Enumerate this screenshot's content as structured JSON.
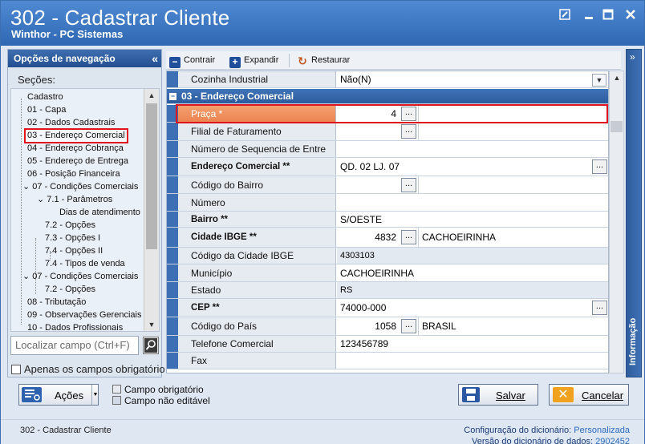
{
  "window": {
    "title": "302 - Cadastrar Cliente",
    "subtitle": "Winthor - PC Sistemas"
  },
  "nav": {
    "header": "Opções de navegação",
    "collapse_glyph": "«",
    "sections_label": "Seções:",
    "tree": [
      {
        "label": "Cadastro"
      },
      {
        "label": "01 - Capa"
      },
      {
        "label": "02 - Dados Cadastrais"
      },
      {
        "label": "03 - Endereço Comercial",
        "selected": true
      },
      {
        "label": "04 - Endereço Cobrança"
      },
      {
        "label": "05 - Endereço de Entrega"
      },
      {
        "label": "06 - Posição Financeira"
      },
      {
        "label": "07 - Condições Comerciais"
      },
      {
        "label": "7.1 - Parâmetros"
      },
      {
        "label": "Dias de atendimento"
      },
      {
        "label": "7.2 - Opções"
      },
      {
        "label": "7.3 - Opções I"
      },
      {
        "label": "7.4 - Opções II"
      },
      {
        "label": "7.4 - Tipos de venda"
      },
      {
        "label": "07 - Condições Comerciais"
      },
      {
        "label": "7.2 - Opções"
      },
      {
        "label": "08 - Tributação"
      },
      {
        "label": "09 - Observações Gerenciais"
      },
      {
        "label": "10 - Dados Profissionais"
      }
    ],
    "search_placeholder": "Localizar campo (Ctrl+F)",
    "required_only_label": "Apenas os campos obrigatório"
  },
  "toolbar": {
    "contrair": "Contrair",
    "expandir": "Expandir",
    "restaurar": "Restaurar"
  },
  "grid": {
    "top_row": {
      "label": "Cozinha Industrial",
      "value": "Não(N)"
    },
    "group": "03 - Endereço Comercial",
    "rows": [
      {
        "label": "Praça *",
        "num": "4",
        "button": true,
        "selected": true
      },
      {
        "label": "Filial de Faturamento",
        "num": "",
        "button": true
      },
      {
        "label": "Número de Sequencia de Entre",
        "text": ""
      },
      {
        "label": "Endereço Comercial **",
        "text": "QD. 02 LJ. 07",
        "bold": true,
        "button_right": true
      },
      {
        "label": "Código do Bairro",
        "num": "",
        "button": true
      },
      {
        "label": "Número",
        "text": ""
      },
      {
        "label": "Bairro **",
        "text": "S/OESTE",
        "bold": true
      },
      {
        "label": "Cidade IBGE **",
        "num": "4832",
        "button": true,
        "extra": "CACHOEIRINHA",
        "bold": true
      },
      {
        "label": "Código da Cidade IBGE",
        "text": "4303103",
        "readonly": true
      },
      {
        "label": "Município",
        "text": "CACHOEIRINHA"
      },
      {
        "label": "Estado",
        "text": "RS",
        "readonly": true
      },
      {
        "label": "CEP **",
        "text": "74000-000",
        "bold": true,
        "button_right": true
      },
      {
        "label": "Código do País",
        "num": "1058",
        "button": true,
        "extra": "BRASIL"
      },
      {
        "label": "Telefone Comercial",
        "text": "123456789"
      },
      {
        "label": "Fax",
        "text": ""
      }
    ]
  },
  "info_panel": {
    "label": "Informação",
    "collapse_glyph": "»"
  },
  "actions": {
    "acoes": "Ações",
    "legend_required": "Campo obrigatório",
    "legend_readonly": "Campo não editável",
    "salvar": "Salvar",
    "cancelar": "Cancelar"
  },
  "status": {
    "left": "302 - Cadastrar Cliente",
    "config_label": "Configuração do dicionário:",
    "config_value": "Personalizada",
    "version_label": "Versão do dicionário de dados:",
    "version_value": "2902452"
  },
  "colors": {
    "titlebar": "#2f67b3",
    "group_header": "#3f73b7",
    "selected_row": "#ec8552",
    "highlight": "#e0141e",
    "cancel_icon": "#f0a11e"
  }
}
